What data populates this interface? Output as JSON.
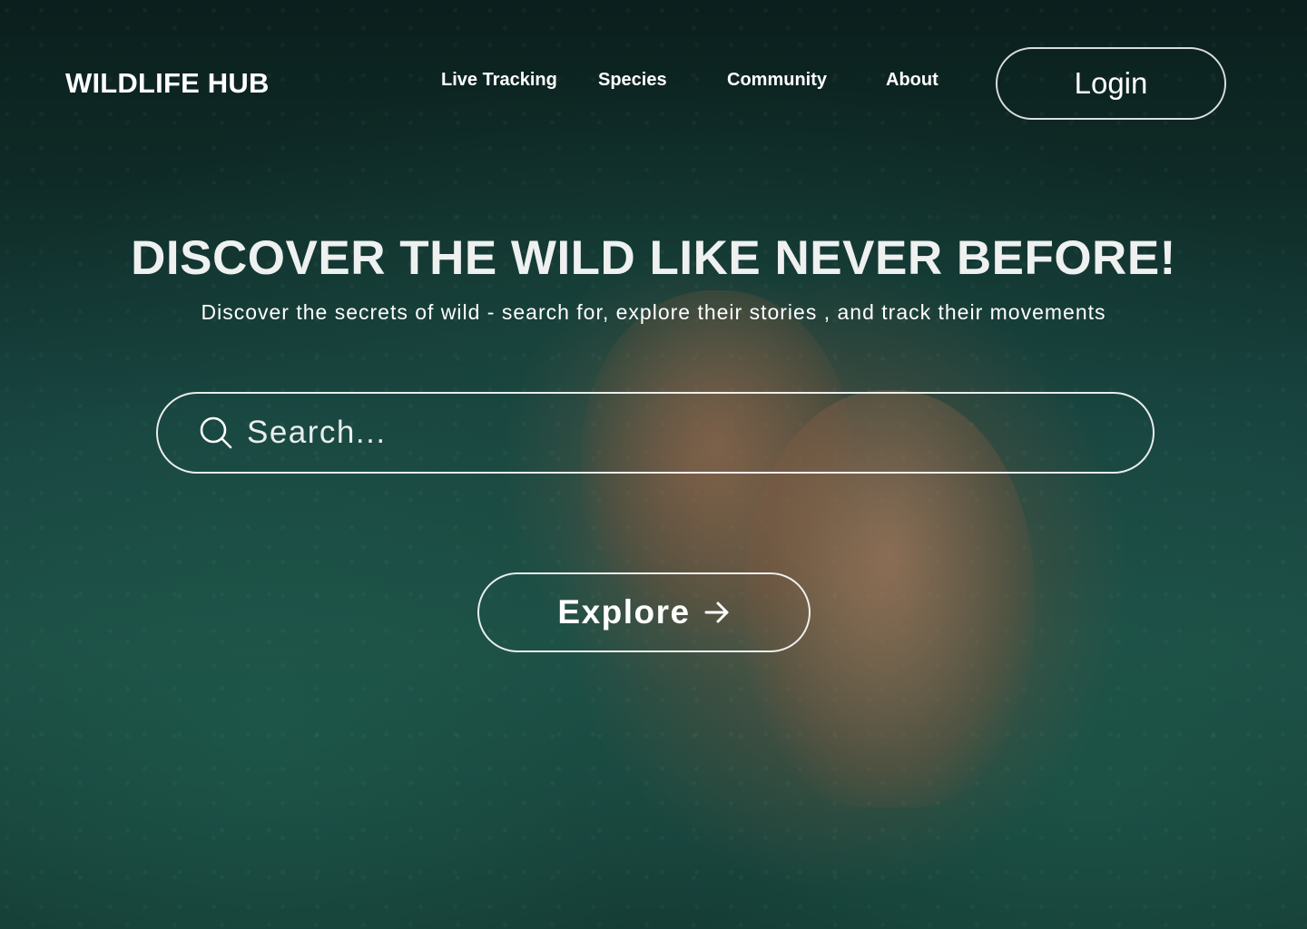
{
  "header": {
    "logo": "WILDLIFE HUB",
    "nav": {
      "live_tracking": "Live Tracking",
      "species": "Species",
      "community": "Community",
      "about": "About"
    },
    "login_label": "Login"
  },
  "hero": {
    "title": "DISCOVER THE WILD LIKE NEVER BEFORE!",
    "subtitle": "Discover the secrets of wild - search for, explore their stories , and track their movements"
  },
  "search": {
    "placeholder": "Search...",
    "value": "",
    "icon": "search-icon"
  },
  "explore": {
    "label": "Explore",
    "icon": "arrow-right-icon"
  },
  "colors": {
    "text": "#ffffff",
    "background_dark": "#0b1f1d",
    "background_green": "#1d4d45"
  }
}
